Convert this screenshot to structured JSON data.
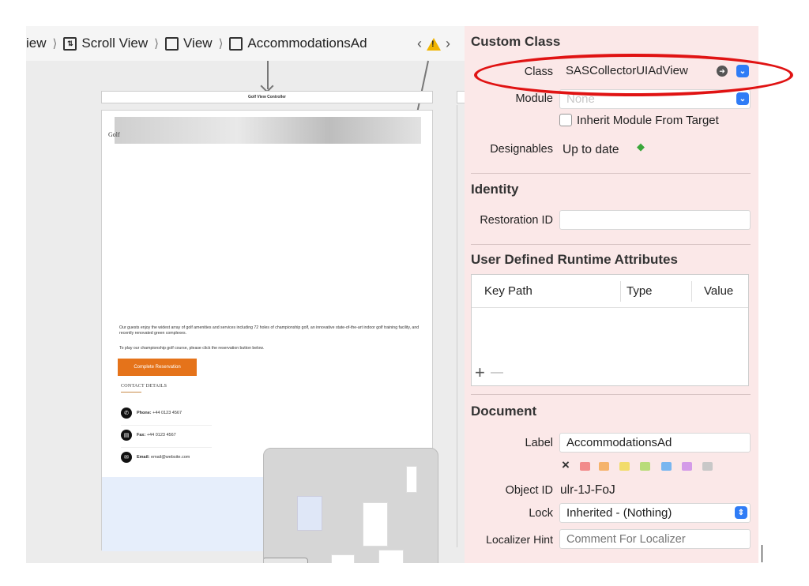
{
  "breadcrumb": {
    "items": [
      "iew",
      "Scroll View",
      "View",
      "AccommodationsAd"
    ]
  },
  "canvas": {
    "vc_title": "Golf View Controller",
    "hero_title": "Golf",
    "description": "Our guests enjoy the widest array of golf amenities and services including 72 holes of championship golf, an innovative state-of-the-art indoor golf training facility, and recently renovated green complexes.",
    "description2": "To play our championship golf course, please click the reservation button below.",
    "reserve_button": "Complete Reservation",
    "contact_title": "CONTACT DETAILS",
    "contacts": [
      {
        "label": "Phone:",
        "value": "+44 0123 4567",
        "icon": "phone-icon"
      },
      {
        "label": "Fax:",
        "value": "+44 0123 4567",
        "icon": "fax-icon"
      },
      {
        "label": "Email:",
        "value": "email@website.com",
        "icon": "email-icon"
      }
    ]
  },
  "inspector": {
    "custom_class": {
      "title": "Custom Class",
      "class_label": "Class",
      "class_value": "SASCollectorUIAdView",
      "module_label": "Module",
      "module_value": "None",
      "inherit_label": "Inherit Module From Target",
      "designables_label": "Designables",
      "designables_value": "Up to date"
    },
    "identity": {
      "title": "Identity",
      "restoration_label": "Restoration ID",
      "restoration_value": ""
    },
    "runtime": {
      "title": "User Defined Runtime Attributes",
      "col_keypath": "Key Path",
      "col_type": "Type",
      "col_value": "Value",
      "add": "+",
      "remove": "—"
    },
    "document": {
      "title": "Document",
      "label_label": "Label",
      "label_value": "AccommodationsAd",
      "clear": "×",
      "swatches": [
        "#f28b8b",
        "#f5b36b",
        "#f2dc6b",
        "#b9dc7a",
        "#79b6f0",
        "#d49be8",
        "#c8c8c8"
      ],
      "object_id_label": "Object ID",
      "object_id_value": "ulr-1J-FoJ",
      "lock_label": "Lock",
      "lock_value": "Inherited - (Nothing)",
      "localizer_label": "Localizer Hint",
      "localizer_placeholder": "Comment For Localizer"
    }
  }
}
